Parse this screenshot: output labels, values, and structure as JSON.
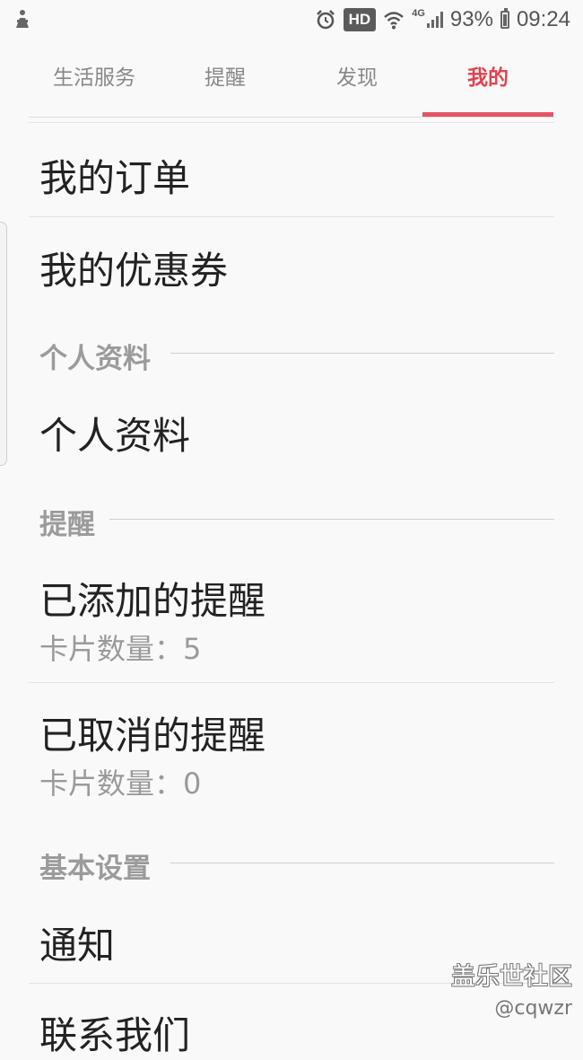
{
  "status_bar": {
    "hd_badge": "HD",
    "network": "4G",
    "battery": "93%",
    "time": "09:24"
  },
  "tabs": [
    {
      "label": "生活服务",
      "active": false
    },
    {
      "label": "提醒",
      "active": false
    },
    {
      "label": "发现",
      "active": false
    },
    {
      "label": "我的",
      "active": true
    }
  ],
  "list": {
    "my_orders": "我的订单",
    "my_coupons": "我的优惠券",
    "section_profile": "个人资料",
    "profile": "个人资料",
    "section_reminders": "提醒",
    "added_reminders": {
      "title": "已添加的提醒",
      "subtitle": "卡片数量：5"
    },
    "cancelled_reminders": {
      "title": "已取消的提醒",
      "subtitle": "卡片数量：0"
    },
    "section_settings": "基本设置",
    "notifications": "通知",
    "contact_us": "联系我们"
  },
  "watermark": {
    "title": "盖乐世社区",
    "handle": "@cqwzr"
  },
  "colors": {
    "accent": "#e2424e",
    "background": "#f9f9f9"
  }
}
